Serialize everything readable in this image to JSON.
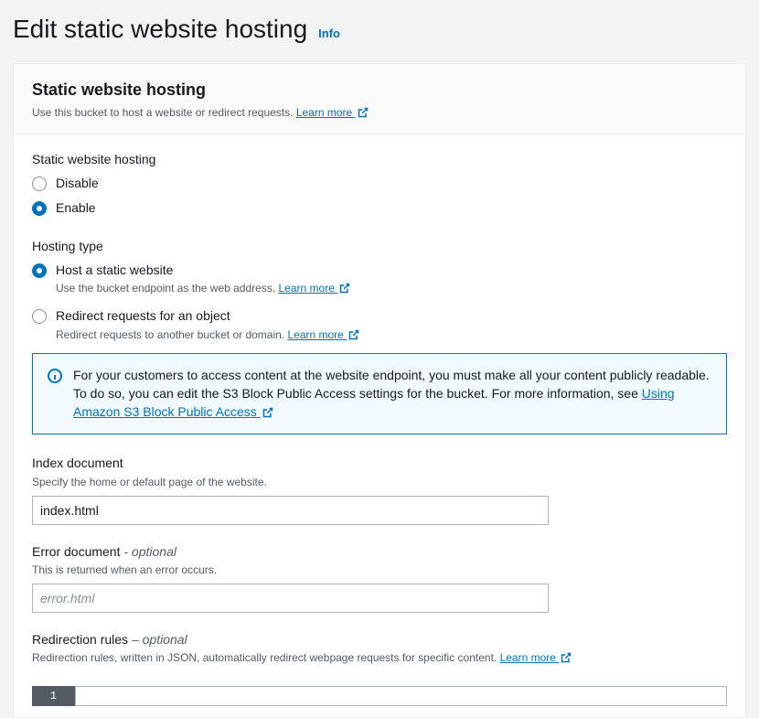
{
  "header": {
    "title": "Edit static website hosting",
    "info": "Info"
  },
  "panel": {
    "title": "Static website hosting",
    "desc": "Use this bucket to host a website or redirect requests.",
    "learn_more": "Learn more"
  },
  "swh": {
    "legend": "Static website hosting",
    "disable": "Disable",
    "enable": "Enable",
    "selected": "enable"
  },
  "hosting_type": {
    "legend": "Hosting type",
    "static": {
      "label": "Host a static website",
      "desc": "Use the bucket endpoint as the web address.",
      "learn_more": "Learn more"
    },
    "redirect": {
      "label": "Redirect requests for an object",
      "desc": "Redirect requests to another bucket or domain.",
      "learn_more": "Learn more"
    },
    "selected": "static"
  },
  "info_box": {
    "text": "For your customers to access content at the website endpoint, you must make all your content publicly readable. To do so, you can edit the S3 Block Public Access settings for the bucket. For more information, see ",
    "link": "Using Amazon S3 Block Public Access"
  },
  "index_doc": {
    "label": "Index document",
    "desc": "Specify the home or default page of the website.",
    "value": "index.html"
  },
  "error_doc": {
    "label": "Error document",
    "optional": "- optional",
    "desc": "This is returned when an error occurs.",
    "placeholder": "error.html",
    "value": ""
  },
  "redirection": {
    "label": "Redirection rules",
    "optional": "– optional",
    "desc": "Redirection rules, written in JSON, automatically redirect webpage requests for specific content.",
    "learn_more": "Learn more",
    "line_number": "1"
  }
}
